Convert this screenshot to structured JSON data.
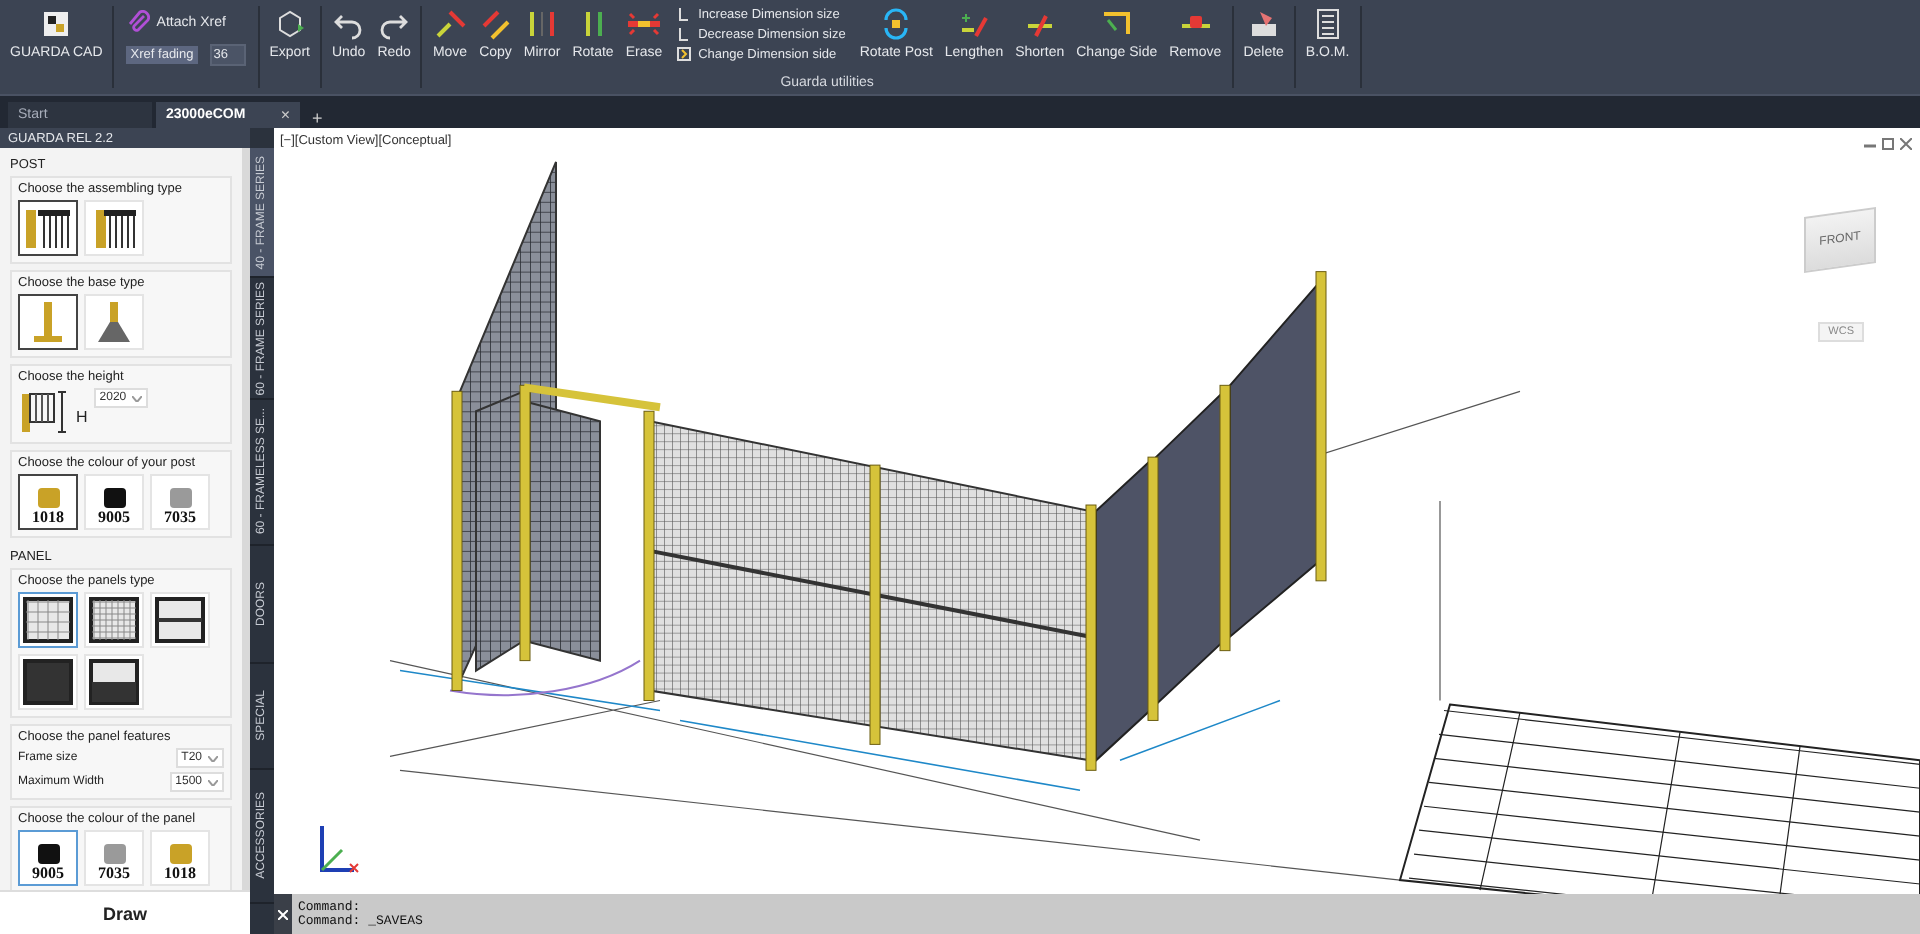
{
  "ribbon": {
    "app_button": {
      "label": "GUARDA CAD"
    },
    "xref": {
      "attach_label": "Attach Xref",
      "fading_label": "Xref fading",
      "fading_value": "36"
    },
    "sections": [
      {
        "items": [
          {
            "kind": "big",
            "label": "Export"
          }
        ]
      },
      {
        "items": [
          {
            "kind": "big",
            "label": "Undo"
          },
          {
            "kind": "big",
            "label": "Redo"
          }
        ]
      },
      {
        "group_label": "Guarda utilities",
        "items": [
          {
            "kind": "big",
            "label": "Move"
          },
          {
            "kind": "big",
            "label": "Copy"
          },
          {
            "kind": "big",
            "label": "Mirror"
          },
          {
            "kind": "big",
            "label": "Rotate"
          },
          {
            "kind": "big",
            "label": "Erase"
          },
          {
            "kind": "stack",
            "entries": [
              "Increase Dimension size",
              "Decrease Dimension size",
              "Change Dimension side"
            ]
          },
          {
            "kind": "big",
            "label": "Rotate Post"
          },
          {
            "kind": "big",
            "label": "Lengthen"
          },
          {
            "kind": "big",
            "label": "Shorten"
          },
          {
            "kind": "big",
            "label": "Change Side"
          },
          {
            "kind": "big",
            "label": "Remove"
          }
        ]
      },
      {
        "items": [
          {
            "kind": "big",
            "label": "Delete"
          }
        ]
      },
      {
        "items": [
          {
            "kind": "big",
            "label": "B.O.M."
          }
        ]
      }
    ]
  },
  "doc_tabs": [
    {
      "label": "Start",
      "selected": false
    },
    {
      "label": "23000eCOM",
      "selected": true
    }
  ],
  "doc_tab_close": "×",
  "doc_tab_add": "+",
  "palette": {
    "title": "GUARDA REL 2.2",
    "sections": [
      {
        "heading": "POST",
        "groups": [
          {
            "kind": "options",
            "label": "Choose the assembling type",
            "options": [
              {
                "selected": true
              },
              {
                "selected": false
              }
            ]
          },
          {
            "kind": "options",
            "label": "Choose the base type",
            "options": [
              {
                "selected": true
              },
              {
                "selected": false
              }
            ]
          },
          {
            "kind": "height",
            "label": "Choose the height",
            "mark": "H",
            "value": "2020"
          },
          {
            "kind": "colors",
            "label": "Choose the colour of your post",
            "options": [
              {
                "label": "1018",
                "color": "#c9a227",
                "selected": true
              },
              {
                "label": "9005",
                "color": "#111111",
                "selected": false
              },
              {
                "label": "7035",
                "color": "#9a9a9a",
                "selected": false
              }
            ]
          }
        ]
      },
      {
        "heading": "PANEL",
        "groups": [
          {
            "kind": "options",
            "label": "Choose the panels type",
            "options": [
              {
                "selected": true
              },
              {
                "selected": false
              },
              {
                "selected": false
              },
              {
                "selected": false
              },
              {
                "selected": false
              }
            ]
          },
          {
            "kind": "fields",
            "label": "Choose the panel features",
            "fields": [
              {
                "label": "Frame size",
                "value": "T20"
              },
              {
                "label": "Maximum Width",
                "value": "1500"
              }
            ]
          },
          {
            "kind": "colors",
            "label": "Choose the colour of the panel",
            "options": [
              {
                "label": "9005",
                "color": "#111111",
                "selected": true
              },
              {
                "label": "7035",
                "color": "#9a9a9a",
                "selected": false
              },
              {
                "label": "1018",
                "color": "#c9a227",
                "selected": false
              }
            ]
          }
        ]
      }
    ],
    "draw_button": "Draw"
  },
  "side_tabs": [
    {
      "label": "40 - FRAME SERIES",
      "selected": true
    },
    {
      "label": "60 - FRAME SERIES",
      "selected": false
    },
    {
      "label": "60 - FRAMELESS SE...",
      "selected": false
    },
    {
      "label": "DOORS",
      "selected": false
    },
    {
      "label": "SPECIAL",
      "selected": false
    },
    {
      "label": "ACCESSORIES",
      "selected": false
    }
  ],
  "viewport": {
    "label": "[−][Custom View][Conceptual]",
    "cube_face": "FRONT",
    "ucs_button": "WCS"
  },
  "command_lines": [
    "Command:",
    "Command: _SAVEAS"
  ]
}
